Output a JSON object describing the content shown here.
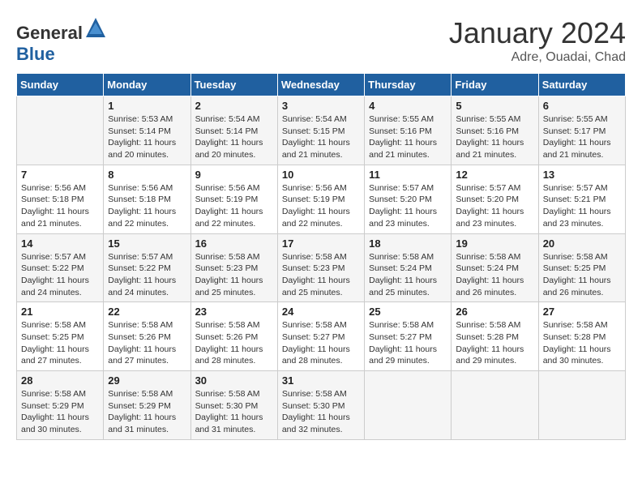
{
  "header": {
    "logo_general": "General",
    "logo_blue": "Blue",
    "month": "January 2024",
    "location": "Adre, Ouadai, Chad"
  },
  "days_of_week": [
    "Sunday",
    "Monday",
    "Tuesday",
    "Wednesday",
    "Thursday",
    "Friday",
    "Saturday"
  ],
  "weeks": [
    [
      {
        "day": "",
        "info": ""
      },
      {
        "day": "1",
        "info": "Sunrise: 5:53 AM\nSunset: 5:14 PM\nDaylight: 11 hours\nand 20 minutes."
      },
      {
        "day": "2",
        "info": "Sunrise: 5:54 AM\nSunset: 5:14 PM\nDaylight: 11 hours\nand 20 minutes."
      },
      {
        "day": "3",
        "info": "Sunrise: 5:54 AM\nSunset: 5:15 PM\nDaylight: 11 hours\nand 21 minutes."
      },
      {
        "day": "4",
        "info": "Sunrise: 5:55 AM\nSunset: 5:16 PM\nDaylight: 11 hours\nand 21 minutes."
      },
      {
        "day": "5",
        "info": "Sunrise: 5:55 AM\nSunset: 5:16 PM\nDaylight: 11 hours\nand 21 minutes."
      },
      {
        "day": "6",
        "info": "Sunrise: 5:55 AM\nSunset: 5:17 PM\nDaylight: 11 hours\nand 21 minutes."
      }
    ],
    [
      {
        "day": "7",
        "info": "Sunrise: 5:56 AM\nSunset: 5:18 PM\nDaylight: 11 hours\nand 21 minutes."
      },
      {
        "day": "8",
        "info": "Sunrise: 5:56 AM\nSunset: 5:18 PM\nDaylight: 11 hours\nand 22 minutes."
      },
      {
        "day": "9",
        "info": "Sunrise: 5:56 AM\nSunset: 5:19 PM\nDaylight: 11 hours\nand 22 minutes."
      },
      {
        "day": "10",
        "info": "Sunrise: 5:56 AM\nSunset: 5:19 PM\nDaylight: 11 hours\nand 22 minutes."
      },
      {
        "day": "11",
        "info": "Sunrise: 5:57 AM\nSunset: 5:20 PM\nDaylight: 11 hours\nand 23 minutes."
      },
      {
        "day": "12",
        "info": "Sunrise: 5:57 AM\nSunset: 5:20 PM\nDaylight: 11 hours\nand 23 minutes."
      },
      {
        "day": "13",
        "info": "Sunrise: 5:57 AM\nSunset: 5:21 PM\nDaylight: 11 hours\nand 23 minutes."
      }
    ],
    [
      {
        "day": "14",
        "info": "Sunrise: 5:57 AM\nSunset: 5:22 PM\nDaylight: 11 hours\nand 24 minutes."
      },
      {
        "day": "15",
        "info": "Sunrise: 5:57 AM\nSunset: 5:22 PM\nDaylight: 11 hours\nand 24 minutes."
      },
      {
        "day": "16",
        "info": "Sunrise: 5:58 AM\nSunset: 5:23 PM\nDaylight: 11 hours\nand 25 minutes."
      },
      {
        "day": "17",
        "info": "Sunrise: 5:58 AM\nSunset: 5:23 PM\nDaylight: 11 hours\nand 25 minutes."
      },
      {
        "day": "18",
        "info": "Sunrise: 5:58 AM\nSunset: 5:24 PM\nDaylight: 11 hours\nand 25 minutes."
      },
      {
        "day": "19",
        "info": "Sunrise: 5:58 AM\nSunset: 5:24 PM\nDaylight: 11 hours\nand 26 minutes."
      },
      {
        "day": "20",
        "info": "Sunrise: 5:58 AM\nSunset: 5:25 PM\nDaylight: 11 hours\nand 26 minutes."
      }
    ],
    [
      {
        "day": "21",
        "info": "Sunrise: 5:58 AM\nSunset: 5:25 PM\nDaylight: 11 hours\nand 27 minutes."
      },
      {
        "day": "22",
        "info": "Sunrise: 5:58 AM\nSunset: 5:26 PM\nDaylight: 11 hours\nand 27 minutes."
      },
      {
        "day": "23",
        "info": "Sunrise: 5:58 AM\nSunset: 5:26 PM\nDaylight: 11 hours\nand 28 minutes."
      },
      {
        "day": "24",
        "info": "Sunrise: 5:58 AM\nSunset: 5:27 PM\nDaylight: 11 hours\nand 28 minutes."
      },
      {
        "day": "25",
        "info": "Sunrise: 5:58 AM\nSunset: 5:27 PM\nDaylight: 11 hours\nand 29 minutes."
      },
      {
        "day": "26",
        "info": "Sunrise: 5:58 AM\nSunset: 5:28 PM\nDaylight: 11 hours\nand 29 minutes."
      },
      {
        "day": "27",
        "info": "Sunrise: 5:58 AM\nSunset: 5:28 PM\nDaylight: 11 hours\nand 30 minutes."
      }
    ],
    [
      {
        "day": "28",
        "info": "Sunrise: 5:58 AM\nSunset: 5:29 PM\nDaylight: 11 hours\nand 30 minutes."
      },
      {
        "day": "29",
        "info": "Sunrise: 5:58 AM\nSunset: 5:29 PM\nDaylight: 11 hours\nand 31 minutes."
      },
      {
        "day": "30",
        "info": "Sunrise: 5:58 AM\nSunset: 5:30 PM\nDaylight: 11 hours\nand 31 minutes."
      },
      {
        "day": "31",
        "info": "Sunrise: 5:58 AM\nSunset: 5:30 PM\nDaylight: 11 hours\nand 32 minutes."
      },
      {
        "day": "",
        "info": ""
      },
      {
        "day": "",
        "info": ""
      },
      {
        "day": "",
        "info": ""
      }
    ]
  ]
}
